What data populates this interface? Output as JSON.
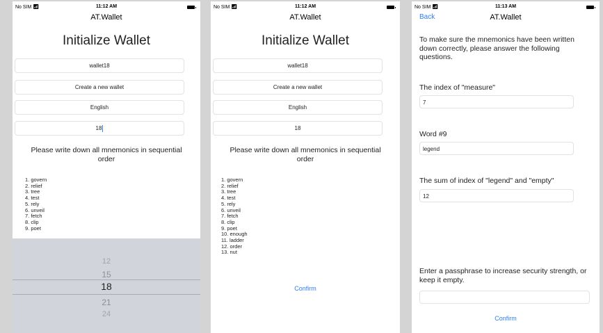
{
  "status": {
    "carrier": "No SIM",
    "time_1": "11:12 AM",
    "time_2": "11:12 AM",
    "time_3": "11:13 AM"
  },
  "app_title": "AT.Wallet",
  "screen1": {
    "title": "Initialize Wallet",
    "wallet_name": "wallet18",
    "wallet_action": "Create a new wallet",
    "language": "English",
    "word_count": "18",
    "instruction": "Please write down all mnemonics in sequential order",
    "mnemonics": [
      "1. govern",
      "2. relief",
      "3. tree",
      "4. test",
      "5. rely",
      "6. unveil",
      "7. fetch",
      "8. clip",
      "9. poet"
    ],
    "picker_values": [
      "12",
      "15",
      "18",
      "21",
      "24"
    ],
    "picker_selected": "18"
  },
  "screen2": {
    "title": "Initialize Wallet",
    "wallet_name": "wallet18",
    "wallet_action": "Create a new wallet",
    "language": "English",
    "word_count": "18",
    "instruction": "Please write down all mnemonics in sequential order",
    "mnemonics": [
      "1. govern",
      "2. relief",
      "3. tree",
      "4. test",
      "5. rely",
      "6. unveil",
      "7. fetch",
      "8. clip",
      "9. poet",
      "10. enough",
      "11. ladder",
      "12. order",
      "13. nut"
    ],
    "confirm_label": "Confirm"
  },
  "screen3": {
    "back_label": "Back",
    "intro": "To make sure the mnemonics have been written down correctly, please answer the following questions.",
    "q1_label": "The index of \"measure\"",
    "q1_value": "7",
    "q2_label": "Word #9",
    "q2_value": "legend",
    "q3_label": "The sum of index of \"legend\" and \"empty\"",
    "q3_value": "12",
    "passphrase_label": "Enter a passphrase to increase security strength, or keep it empty.",
    "passphrase_value": "",
    "confirm_label": "Confirm"
  }
}
